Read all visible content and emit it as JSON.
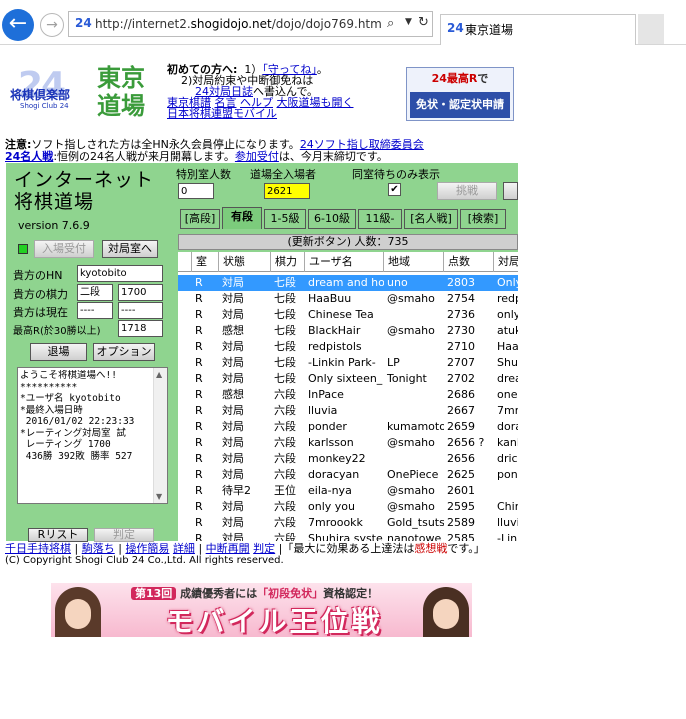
{
  "browser": {
    "url_prefix": "http://internet2.",
    "url_domain": "shogidojo.net",
    "url_path": "/dojo/dojo769.htm",
    "favicon_text": "24",
    "tab_title": "東京道場"
  },
  "header": {
    "logo_big": "24",
    "logo_ja": "将棋倶楽部",
    "logo_en": "Shogi Club 24",
    "dojo_line1": "東京",
    "dojo_line2": "道場",
    "intro_label": "初めての方へ:",
    "intro_1_prefix": "1）",
    "intro_1_link": "「守ってね」",
    "intro_1_suffix": "。",
    "intro_2": "2)対局約束や中断御免ねは",
    "intro_2_link": "24対局日誌",
    "intro_2_suffix": "へ書込んで。",
    "links": [
      "東京棋譜",
      "名言",
      "ヘルプ",
      "大阪道場も開く",
      "日本将棋連盟モバイル"
    ],
    "banner_top_red": "24最高R",
    "banner_top_rest": "で",
    "banner_bottom": "免状・認定状申請"
  },
  "notice": {
    "line1_bold": "注意:",
    "line1_text": "ソフト指しされた方は全HN永久会員停止になります。",
    "line1_link": "24ソフト指し取締委員会",
    "line2_link": "24名人戦",
    "line2_text": ":恒例の24名人戦が来月開幕します。",
    "line2_link2": "参加受付",
    "line2_suffix": "は、今月末締切です。"
  },
  "app": {
    "title_line1": "インターネット",
    "title_line2": "将棋道場",
    "version": "version 7.6.9",
    "enter_button": "入場受付",
    "room_button": "対局室へ",
    "hn_label": "貴方のHN",
    "hn_value": "kyotobito",
    "rank_label": "貴方の棋力",
    "rank_value": "二段",
    "rating_value": "1700",
    "now_label": "貴方は現在",
    "now_value1": "----",
    "now_value2": "----",
    "max_label": "最高R(於30勝以上)",
    "max_value": "1718",
    "exit_button": "退場",
    "options_button": "オプション",
    "welcome_text": "ようこそ将棋道場へ!!\n**********\n*ユーザ名 kyotobito\n*最終入場日時\n 2016/01/02 22:23:33\n*レーティング対局室 試\n レーティング 1700\n 436勝 392敗 勝率 527",
    "rlist_button": "Rリスト",
    "judge_button": "判定"
  },
  "top_controls": {
    "special_label": "特別室人数",
    "special_value": "0",
    "total_label": "道場全入場者",
    "total_value": "2621",
    "same_room_label": "同室待ちのみ表示",
    "same_room_checked": "✔",
    "challenge_button": "挑戦"
  },
  "tabs": [
    "[高段]",
    "有段",
    "1-5級",
    "6-10級",
    "11級-",
    "[名人戦]",
    "[検索]"
  ],
  "count_bar": "(更新ボタン) 人数：735",
  "table": {
    "headers": [
      "室",
      "状態",
      "棋力",
      "ユーザ名",
      "地域",
      "点数",
      "対局"
    ],
    "rows": [
      [
        "R",
        "対局",
        "七段",
        "dream and hope",
        "uno",
        "2803",
        "Only"
      ],
      [
        "R",
        "対局",
        "七段",
        "HaaBuu",
        "@smaho",
        "2754",
        "redp"
      ],
      [
        "R",
        "対局",
        "七段",
        "Chinese Tea",
        "",
        "2736",
        "only"
      ],
      [
        "R",
        "感想",
        "七段",
        "BlackHair",
        "@smaho",
        "2730",
        "atuk"
      ],
      [
        "R",
        "対局",
        "七段",
        "redpistols",
        "",
        "2710",
        "Haa"
      ],
      [
        "R",
        "対局",
        "七段",
        "-Linkin Park-",
        "LP",
        "2707",
        "Shu"
      ],
      [
        "R",
        "対局",
        "七段",
        "Only sixteen_",
        "Tonight",
        "2702",
        "drea"
      ],
      [
        "R",
        "感想",
        "六段",
        "InPace",
        "",
        "2686",
        "one"
      ],
      [
        "R",
        "対局",
        "六段",
        "lluvia",
        "",
        "2667",
        "7mr"
      ],
      [
        "R",
        "対局",
        "六段",
        "ponder",
        "kumamoto",
        "2659",
        "dora"
      ],
      [
        "R",
        "対局",
        "六段",
        "karlsson",
        "@smaho",
        "2656 ?",
        "kanl"
      ],
      [
        "R",
        "対局",
        "六段",
        "monkey22",
        "",
        "2656",
        "dric"
      ],
      [
        "R",
        "対局",
        "六段",
        "doracyan",
        "OnePiece",
        "2625",
        "pon"
      ],
      [
        "R",
        "待早2",
        "王位",
        "eila-nya",
        "@smaho",
        "2601",
        ""
      ],
      [
        "R",
        "対局",
        "六段",
        "only you",
        "@smaho",
        "2595",
        "Chir"
      ],
      [
        "R",
        "対局",
        "六段",
        "7mroookk",
        "Gold_tsuts",
        "2589",
        "lluvi"
      ],
      [
        "R",
        "対局",
        "六段",
        "Shuhira syste",
        "nanotowe",
        "2585",
        "-Lin"
      ]
    ]
  },
  "footer": {
    "links": [
      "千日手持将棋",
      "駒落ち",
      "操作簡易",
      "詳細",
      "中断再開",
      "判定"
    ],
    "sep": "|",
    "quote_prefix": "「最大に効果ある上達法は",
    "quote_red": "感想戦",
    "quote_suffix": "です。」",
    "copyright": "(C) Copyright Shogi Club 24 Co.,Ltd. All rights reserved."
  },
  "ad": {
    "round": "第13回",
    "sub_prefix": "成績優秀者には",
    "sub_red": "「初段免状」",
    "sub_suffix": "資格認定！",
    "main": "モバイル王位戦"
  }
}
